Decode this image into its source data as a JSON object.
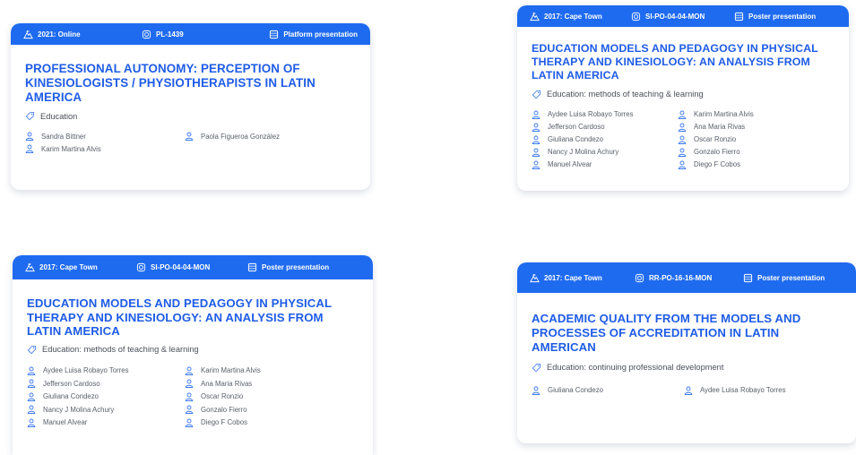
{
  "colors": {
    "accent": "#1f6bf0",
    "title": "#1f5ce6",
    "text": "#4a4f5a",
    "icon": "#3a78f0"
  },
  "icons": {
    "location": "mountain-icon",
    "code": "tag-code-icon",
    "type": "presentation-icon",
    "topic": "tag-icon",
    "author": "person-icon"
  },
  "cards": [
    {
      "location": "2021: Online",
      "code": "PL-1439",
      "type": "Platform presentation",
      "title": "PROFESSIONAL AUTONOMY: PERCEPTION OF KINESIOLOGISTS / PHYSIOTHERAPISTS IN LATIN AMERICA",
      "topic": "Education",
      "authors": [
        "Sandra Bittner",
        "Paola Figueroa González",
        "Karim Martina Alvis"
      ]
    },
    {
      "location": "2017: Cape Town",
      "code": "SI-PO-04-04-MON",
      "type": "Poster presentation",
      "title": "EDUCATION MODELS AND PEDAGOGY IN PHYSICAL THERAPY AND KINESIOLOGY: AN ANALYSIS FROM LATIN AMERICA",
      "topic": "Education: methods of teaching & learning",
      "authors": [
        "Aydee Luisa Robayo Torres",
        "Karim Martina Alvis",
        "Jefferson Cardoso",
        "Ana Maria Rivas",
        "Giuliana Condezo",
        "Oscar Ronzio",
        "Nancy J Molina Achury",
        "Gonzalo Fierro",
        "Manuel Alvear",
        "Diego F Cobos"
      ]
    },
    {
      "location": "2017: Cape Town",
      "code": "SI-PO-04-04-MON",
      "type": "Poster presentation",
      "title": "EDUCATION MODELS AND PEDAGOGY IN PHYSICAL THERAPY AND KINESIOLOGY: AN ANALYSIS FROM LATIN AMERICA",
      "topic": "Education: methods of teaching & learning",
      "authors": [
        "Aydee Luisa Robayo Torres",
        "Karim Martina Alvis",
        "Jefferson Cardoso",
        "Ana Maria Rivas",
        "Giuliana Condezo",
        "Oscar Ronzio",
        "Nancy J Molina Achury",
        "Gonzalo Fierro",
        "Manuel Alvear",
        "Diego F Cobos"
      ]
    },
    {
      "location": "2017: Cape Town",
      "code": "RR-PO-16-16-MON",
      "type": "Poster presentation",
      "title": "ACADEMIC QUALITY FROM THE MODELS AND PROCESSES OF ACCREDITATION IN LATIN AMERICAN",
      "topic": "Education: continuing professional development",
      "authors": [
        "Giuliana Condezo",
        "Aydee Luisa Robayo Torres"
      ]
    }
  ]
}
